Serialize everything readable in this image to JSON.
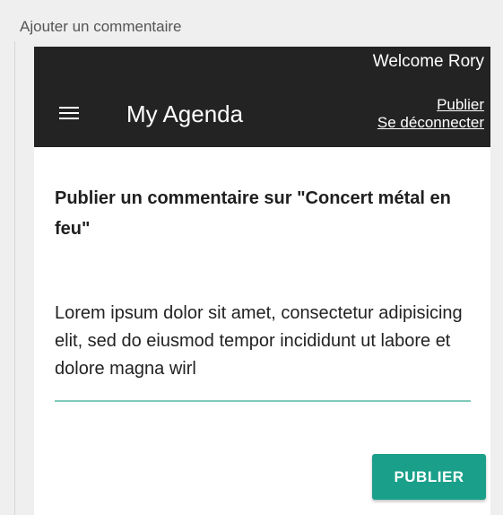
{
  "frame": {
    "title": "Ajouter un commentaire"
  },
  "header": {
    "welcome": "Welcome Rory",
    "app_title": "My Agenda",
    "menu_icon": "hamburger-menu-icon",
    "links": {
      "publish": "Publier",
      "logout": "Se déconnecter"
    },
    "background_color": "#232323"
  },
  "main": {
    "heading": "Publier un commentaire sur \"Concert métal en feu\"",
    "comment_value": "Lorem ipsum dolor sit amet, consectetur adipisicing elit, sed do eiusmod tempor incididunt ut labore et dolore magna wirl",
    "submit_label": "PUBLIER",
    "accent_color": "#1aa08a",
    "underline_color": "#7fc9ba"
  }
}
